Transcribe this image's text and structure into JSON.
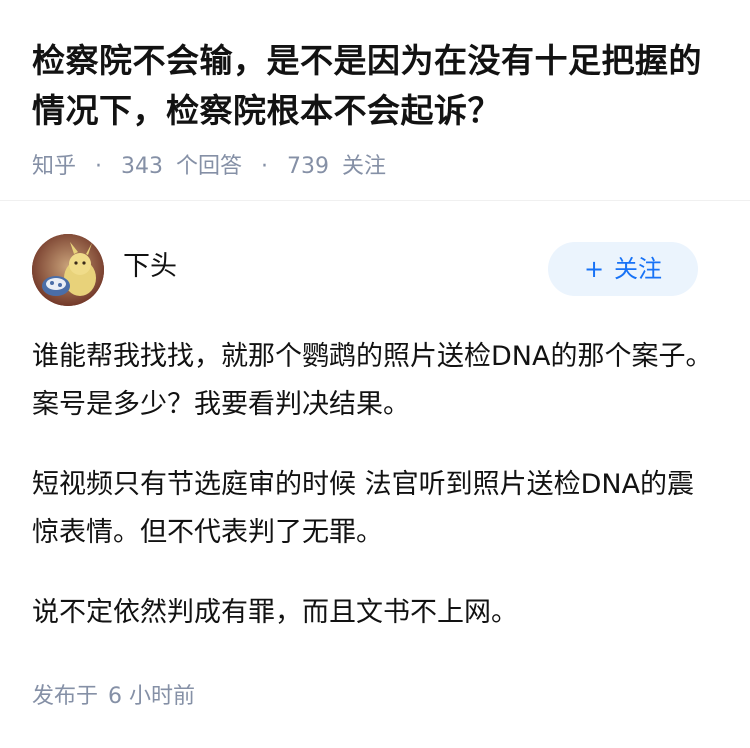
{
  "question": {
    "title": "检察院不会输，是不是因为在没有十足把握的情况下，检察院根本不会起诉？",
    "source": "知乎",
    "answer_count": "343",
    "answer_count_label": "个回答",
    "follower_count": "739",
    "follower_label": "关注"
  },
  "author": {
    "name": "下头",
    "follow_label": "关注",
    "follow_icon": "plus-icon"
  },
  "answer": {
    "paragraphs": [
      "谁能帮我找找，就那个鹦鹉的照片送检DNA的那个案子。案号是多少？我要看判决结果。",
      "短视频只有节选庭审的时候 法官听到照片送检DNA的震惊表情。但不代表判了无罪。",
      "说不定依然判成有罪，而且文书不上网。"
    ]
  },
  "footer": {
    "published_label": "发布于",
    "published_time": "6 小时前"
  },
  "colors": {
    "accent": "#1772f6",
    "button_bg": "#ebf4fd",
    "meta_gray": "#8590a6",
    "text": "#121212"
  }
}
